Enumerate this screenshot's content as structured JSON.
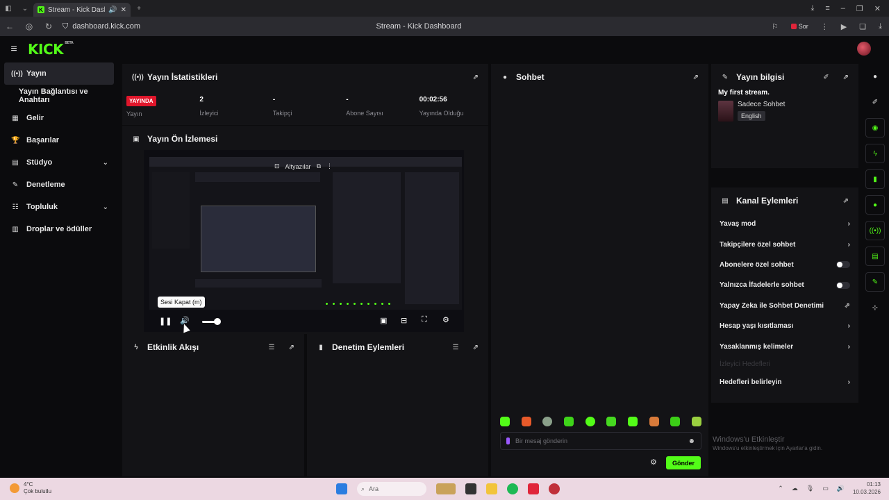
{
  "browser": {
    "tab_title": "Stream - Kick Dashb",
    "url": "dashboard.kick.com",
    "page_title": "Stream - Kick Dashboard",
    "sor_label": "Sor"
  },
  "header": {
    "logo": "KICK",
    "logo_badge": "BETA"
  },
  "sidebar": {
    "items": [
      {
        "label": "Yayın",
        "icon": "broadcast-icon"
      },
      {
        "label": "Yayın Bağlantısı ve Anahtarı",
        "icon": ""
      },
      {
        "label": "Gelir",
        "icon": "revenue-icon"
      },
      {
        "label": "Başarılar",
        "icon": "trophy-icon"
      },
      {
        "label": "Stüdyo",
        "icon": "studio-icon"
      },
      {
        "label": "Denetleme",
        "icon": "wrench-icon"
      },
      {
        "label": "Topluluk",
        "icon": "community-icon"
      },
      {
        "label": "Droplar ve ödüller",
        "icon": "drops-icon"
      }
    ]
  },
  "stats_panel": {
    "title": "Yayın İstatistikleri",
    "live_badge": "YAYINDA",
    "live_label": "Yayın",
    "viewers_value": "2",
    "viewers_label": "İzleyici",
    "followers_value": "-",
    "followers_label": "Takipçi",
    "subs_value": "-",
    "subs_label": "Abone Sayısı",
    "duration_value": "00:02:56",
    "duration_label": "Yayında Olduğu"
  },
  "preview_panel": {
    "title": "Yayın Ön İzlemesi",
    "subtitles_label": "Altyazılar",
    "tooltip": "Sesi Kapat (m)",
    "volume_level": 0.6
  },
  "activity_panel": {
    "title": "Etkinlik Akışı"
  },
  "moderation_panel": {
    "title": "Denetim Eylemleri"
  },
  "chat_panel": {
    "title": "Sohbet",
    "input_placeholder": "Bir mesaj gönderin",
    "send_label": "Gönder"
  },
  "info_panel": {
    "title": "Yayın bilgisi",
    "stream_title": "My first stream.",
    "category": "Sadece Sohbet",
    "language": "English"
  },
  "channel_actions": {
    "title": "Kanal Eylemleri",
    "items": [
      {
        "label": "Yavaş mod",
        "kind": "chevron"
      },
      {
        "label": "Takipçilere özel sohbet",
        "kind": "chevron"
      },
      {
        "label": "Abonelere özel sohbet",
        "kind": "toggle"
      },
      {
        "label": "Yalnızca İfadelerle sohbet",
        "kind": "toggle"
      },
      {
        "label": "Yapay Zeka ile Sohbet Denetimi",
        "kind": "external"
      },
      {
        "label": "Hesap yaşı kısıtlaması",
        "kind": "chevron"
      },
      {
        "label": "Yasaklanmış kelimeler",
        "kind": "chevron"
      },
      {
        "label": "İzleyici Hedefleri",
        "kind": "dim"
      },
      {
        "label": "Hedefleri belirleyin",
        "kind": "chevron"
      }
    ]
  },
  "watermark": {
    "line1": "Windows'u Etkinleştir",
    "line2": "Windows'u etkinleştirmek için Ayarlar'a gidin."
  },
  "taskbar": {
    "temperature": "4°C",
    "weather": "Çok bulutlu",
    "search_placeholder": "Ara",
    "time": "01:13",
    "date": "10.03.2026"
  },
  "colors": {
    "accent": "#53fc18",
    "live": "#e0162b",
    "panel": "#131316",
    "background": "#0b0b0d"
  }
}
